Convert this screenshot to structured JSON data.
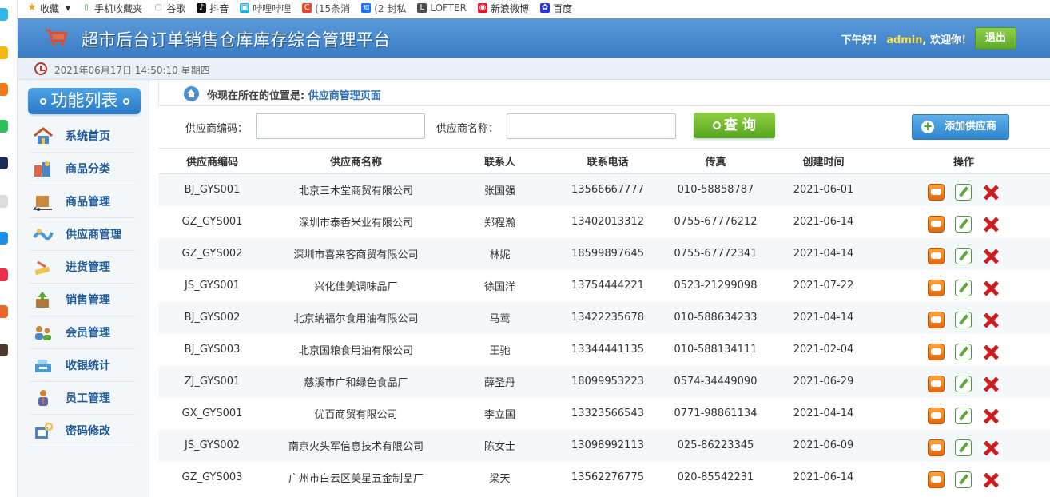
{
  "browser": {
    "bookmarks": [
      {
        "label": "收藏",
        "icon": "star-icon",
        "color": "#f0a020",
        "glyph": "★"
      },
      {
        "label": "手机收藏夹",
        "icon": "phone-icon",
        "color": "#3aa04a",
        "glyph": "▯"
      },
      {
        "label": "谷歌",
        "icon": "page-icon",
        "color": "#999999",
        "glyph": "▢"
      },
      {
        "label": "抖音",
        "icon": "tiktok-icon",
        "color": "#111111",
        "glyph": "♪"
      },
      {
        "label": "哔哩哔哩",
        "icon": "bilibili-icon",
        "color": "#23ade5",
        "glyph": "▣"
      },
      {
        "label": "(15条消",
        "icon": "csdn-icon",
        "color": "#e5482a",
        "glyph": "C"
      },
      {
        "label": "(2 封私",
        "icon": "zhihu-icon",
        "color": "#1772f6",
        "glyph": "知"
      },
      {
        "label": "LOFTER",
        "icon": "lofter-icon",
        "color": "#4a4a4a",
        "glyph": "L"
      },
      {
        "label": "新浪微博",
        "icon": "weibo-icon",
        "color": "#e6162d",
        "glyph": "◉"
      },
      {
        "label": "百度",
        "icon": "baidu-icon",
        "color": "#2932e1",
        "glyph": "✿"
      }
    ]
  },
  "header": {
    "title": "超市后台订单销售仓库库存综合管理平台",
    "greeting_prefix": "下午好！",
    "username": "admin",
    "greeting_suffix": ", 欢迎你！",
    "logout_label": "退出"
  },
  "timebar": {
    "datetime": "2021年06月17日 14:50:10 星期四"
  },
  "sidebar": {
    "title": "功能列表",
    "items": [
      {
        "label": "系统首页",
        "icon": "home-menu-icon"
      },
      {
        "label": "商品分类",
        "icon": "category-icon"
      },
      {
        "label": "商品管理",
        "icon": "goods-icon"
      },
      {
        "label": "供应商管理",
        "icon": "supplier-icon"
      },
      {
        "label": "进货管理",
        "icon": "purchase-icon"
      },
      {
        "label": "销售管理",
        "icon": "sales-icon"
      },
      {
        "label": "会员管理",
        "icon": "member-icon"
      },
      {
        "label": "收银统计",
        "icon": "cashier-icon"
      },
      {
        "label": "员工管理",
        "icon": "staff-icon"
      },
      {
        "label": "密码修改",
        "icon": "password-icon"
      }
    ]
  },
  "breadcrumb": {
    "prefix": "你现在所在的位置是:",
    "page": "供应商管理页面"
  },
  "search": {
    "code_label": "供应商编码：",
    "code_value": "",
    "name_label": "供应商名称：",
    "name_value": "",
    "search_button": "查 询",
    "add_button": "添加供应商"
  },
  "table": {
    "columns": [
      "供应商编码",
      "供应商名称",
      "联系人",
      "联系电话",
      "传真",
      "创建时间",
      "操作"
    ],
    "rows": [
      [
        "BJ_GYS001",
        "北京三木堂商贸有限公司",
        "张国强",
        "13566667777",
        "010-58858787",
        "2021-06-01"
      ],
      [
        "GZ_GYS001",
        "深圳市泰香米业有限公司",
        "郑程瀚",
        "13402013312",
        "0755-67776212",
        "2021-06-14"
      ],
      [
        "GZ_GYS002",
        "深圳市喜来客商贸有限公司",
        "林妮",
        "18599897645",
        "0755-67772341",
        "2021-04-14"
      ],
      [
        "JS_GYS001",
        "兴化佳美调味品厂",
        "徐国洋",
        "13754444221",
        "0523-21299098",
        "2021-07-22"
      ],
      [
        "BJ_GYS002",
        "北京纳福尔食用油有限公司",
        "马莺",
        "13422235678",
        "010-588634233",
        "2021-04-14"
      ],
      [
        "BJ_GYS003",
        "北京国粮食用油有限公司",
        "王驰",
        "13344441135",
        "010-588134111",
        "2021-02-04"
      ],
      [
        "ZJ_GYS001",
        "慈溪市广和绿色食品厂",
        "薛圣丹",
        "18099953223",
        "0574-34449090",
        "2021-06-29"
      ],
      [
        "GX_GYS001",
        "优百商贸有限公司",
        "李立国",
        "13323566543",
        "0771-98861134",
        "2021-04-14"
      ],
      [
        "JS_GYS002",
        "南京火头军信息技术有限公司",
        "陈女士",
        "13098992113",
        "025-86223345",
        "2021-06-09"
      ],
      [
        "GZ_GYS003",
        "广州市白云区美星五金制品厂",
        "梁天",
        "13562276775",
        "020-85542231",
        "2021-06-14"
      ]
    ]
  },
  "colors": {
    "header_blue": "#3a7cc4",
    "accent_green": "#5ca82b",
    "link_blue": "#2a6fb5",
    "delete_red": "#d21c1c"
  }
}
